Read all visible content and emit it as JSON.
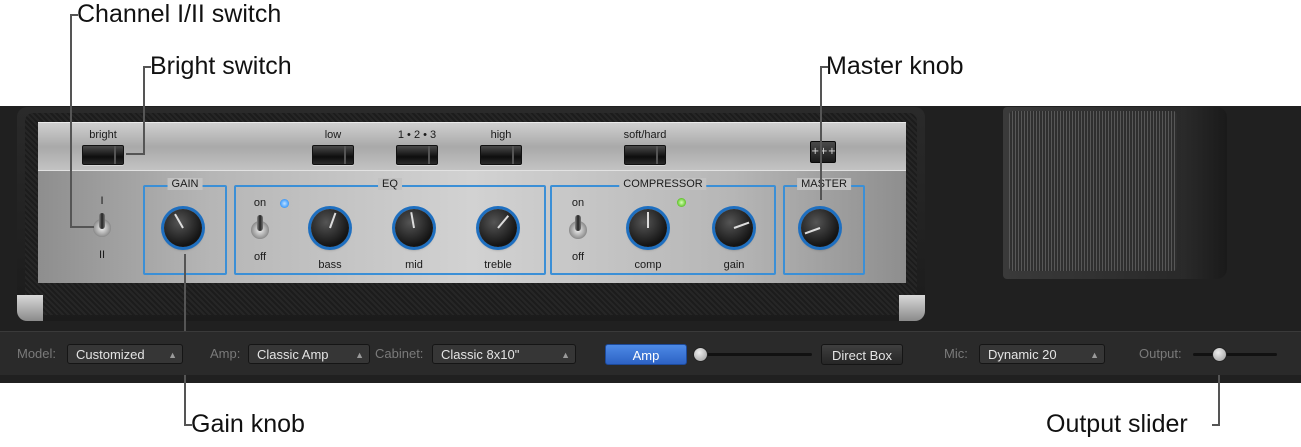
{
  "callouts": {
    "channel_switch": "Channel I/II switch",
    "bright_switch": "Bright switch",
    "master_knob": "Master knob",
    "gain_knob": "Gain knob",
    "output_slider": "Output slider"
  },
  "amp_head": {
    "toggles": {
      "bright": "bright",
      "low": "low",
      "channel_123": "1 • 2 • 3",
      "high": "high",
      "soft_hard": "soft/hard"
    },
    "settings_icon": "expand-icon",
    "channel_switch": {
      "top": "I",
      "bottom": "II"
    },
    "sections": {
      "gain": "GAIN",
      "eq": "EQ",
      "compressor": "COMPRESSOR",
      "master": "MASTER"
    },
    "eq": {
      "on": "on",
      "off": "off",
      "bass": "bass",
      "mid": "mid",
      "treble": "treble"
    },
    "compressor": {
      "on": "on",
      "off": "off",
      "comp": "comp",
      "gain": "gain"
    },
    "leds": {
      "eq": "#4aa3ff",
      "compressor": "#6fcf3a"
    }
  },
  "toolbar": {
    "model_label": "Model:",
    "model_value": "Customized",
    "amp_label": "Amp:",
    "amp_value": "Classic Amp",
    "cabinet_label": "Cabinet:",
    "cabinet_value": "Classic 8x10\"",
    "amp_button": "Amp",
    "direct_box_button": "Direct Box",
    "mic_label": "Mic:",
    "mic_value": "Dynamic 20",
    "output_label": "Output:"
  },
  "colors": {
    "accent": "#3b8fd6",
    "amp_button": "#3c78d8"
  }
}
